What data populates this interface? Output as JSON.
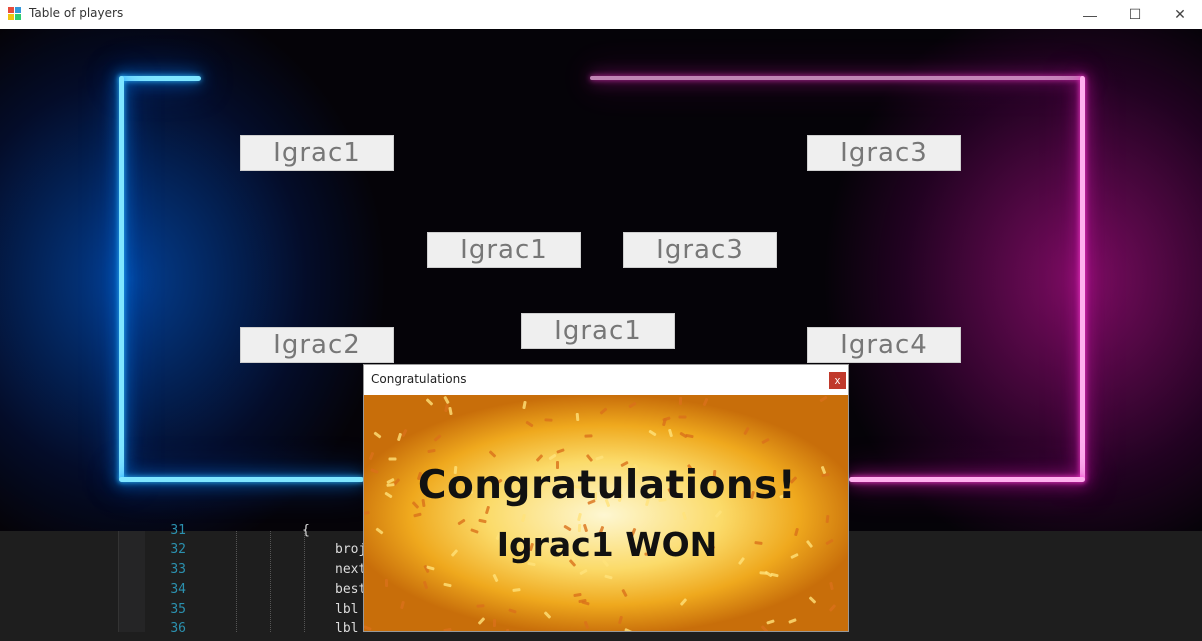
{
  "window": {
    "title": "Table of players",
    "minimize": "—",
    "maximize": "☐",
    "close": "✕"
  },
  "players": {
    "left_top": "Igrac1",
    "left_bottom": "Igrac2",
    "right_top": "Igrac3",
    "right_bottom": "Igrac4",
    "semi_left": "Igrac1",
    "semi_right": "Igrac3",
    "final": "Igrac1"
  },
  "editor": {
    "lines": [
      {
        "number": "31",
        "code": "{"
      },
      {
        "number": "32",
        "code": "broj"
      },
      {
        "number": "33",
        "code": "next"
      },
      {
        "number": "34",
        "code": "best"
      },
      {
        "number": "35",
        "code": "lbl"
      },
      {
        "number": "36",
        "code": "lbl"
      }
    ]
  },
  "dialog": {
    "title": "Congratulations",
    "close": "x",
    "heading": "Congratulations!",
    "winner": "Igrac1 WON"
  },
  "colors": {
    "neon_blue": "#29b6ff",
    "neon_pink": "#ff3ad4",
    "dialog_close": "#c0392b"
  }
}
